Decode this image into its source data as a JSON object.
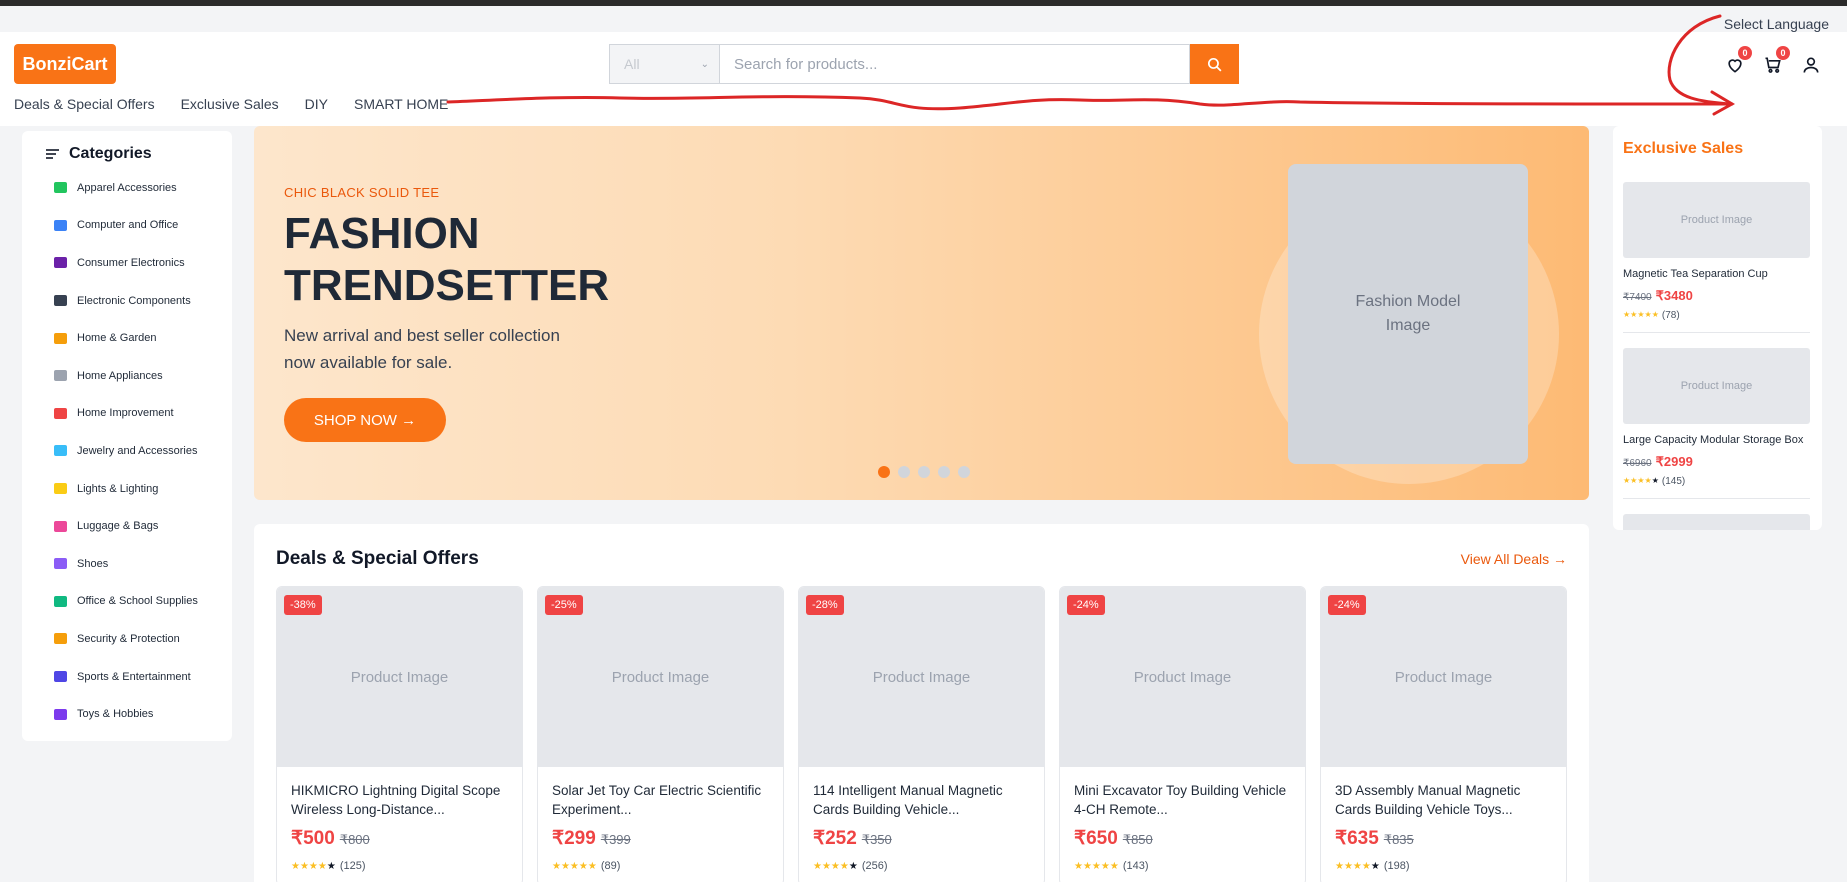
{
  "top": {
    "language_label": "Select Language"
  },
  "header": {
    "logo": "BonziCart",
    "search": {
      "category": "All",
      "placeholder": "Search for products..."
    },
    "wishlist_count": "0",
    "cart_count": "0"
  },
  "nav": [
    "Deals & Special Offers",
    "Exclusive Sales",
    "DIY",
    "SMART HOME"
  ],
  "sidebar": {
    "title": "Categories",
    "items": [
      {
        "label": "Apparel Accessories",
        "color": "#22c55e"
      },
      {
        "label": "Computer and Office",
        "color": "#3b82f6"
      },
      {
        "label": "Consumer Electronics",
        "color": "#6b21a8"
      },
      {
        "label": "Electronic Components",
        "color": "#374151"
      },
      {
        "label": "Home & Garden",
        "color": "#f59e0b"
      },
      {
        "label": "Home Appliances",
        "color": "#9ca3af"
      },
      {
        "label": "Home Improvement",
        "color": "#ef4444"
      },
      {
        "label": "Jewelry and Accessories",
        "color": "#38bdf8"
      },
      {
        "label": "Lights & Lighting",
        "color": "#facc15"
      },
      {
        "label": "Luggage & Bags",
        "color": "#ec4899"
      },
      {
        "label": "Shoes",
        "color": "#8b5cf6"
      },
      {
        "label": "Office & School Supplies",
        "color": "#10b981"
      },
      {
        "label": "Security & Protection",
        "color": "#f59e0b"
      },
      {
        "label": "Sports & Entertainment",
        "color": "#4f46e5"
      },
      {
        "label": "Toys & Hobbies",
        "color": "#7c3aed"
      }
    ]
  },
  "hero": {
    "tag": "CHIC BLACK SOLID TEE",
    "title_line1": "FASHION",
    "title_line2": "TRENDSETTER",
    "subtitle": "New arrival and best seller collection now available for sale.",
    "button": "SHOP NOW →",
    "image_label": "Fashion Model Image",
    "active_slide": 1,
    "slide_count": 5
  },
  "deals": {
    "title": "Deals & Special Offers",
    "view_all": "View All Deals →",
    "image_label": "Product Image",
    "products": [
      {
        "discount": "-38%",
        "name": "HIKMICRO Lightning Digital Scope Wireless Long-Distance...",
        "price": "₹500",
        "old_price": "₹800",
        "rating": 4,
        "reviews": "(125)"
      },
      {
        "discount": "-25%",
        "name": "Solar Jet Toy Car Electric Scientific Experiment...",
        "price": "₹299",
        "old_price": "₹399",
        "rating": 5,
        "reviews": "(89)"
      },
      {
        "discount": "-28%",
        "name": "114 Intelligent Manual Magnetic Cards Building Vehicle...",
        "price": "₹252",
        "old_price": "₹350",
        "rating": 4,
        "reviews": "(256)"
      },
      {
        "discount": "-24%",
        "name": "Mini Excavator Toy Building Vehicle 4-CH Remote...",
        "price": "₹650",
        "old_price": "₹850",
        "rating": 5,
        "reviews": "(143)"
      },
      {
        "discount": "-24%",
        "name": "3D Assembly Manual Magnetic Cards Building Vehicle Toys...",
        "price": "₹635",
        "old_price": "₹835",
        "rating": 4,
        "reviews": "(198)"
      }
    ]
  },
  "exclusive": {
    "title": "Exclusive Sales",
    "image_label": "Product Image",
    "items": [
      {
        "name": "Magnetic Tea Separation Cup",
        "old_price": "₹7400",
        "price": "₹3480",
        "rating": 5,
        "reviews": "(78)"
      },
      {
        "name": "Large Capacity Modular Storage Box",
        "old_price": "₹6960",
        "price": "₹2999",
        "rating": 4,
        "reviews": "(145)"
      }
    ]
  },
  "colors": {
    "brand": "#f97316",
    "sale": "#ef4444",
    "annotation": "#dc2626"
  }
}
